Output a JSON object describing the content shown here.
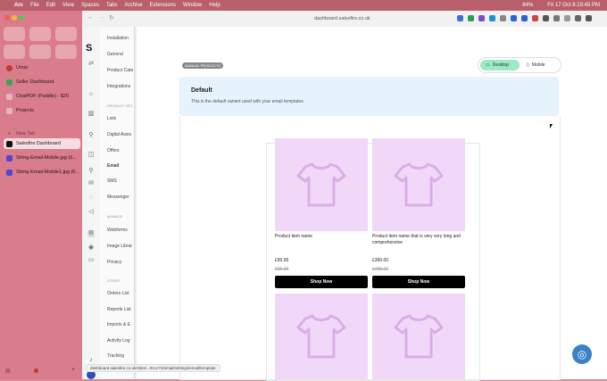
{
  "menubar": {
    "items": [
      "Arc",
      "File",
      "Edit",
      "View",
      "Spaces",
      "Tabs",
      "Archive",
      "Extensions",
      "Window",
      "Help"
    ],
    "battery": "84%",
    "datetime": "Fri 17 Oct  8:19:45 PM"
  },
  "arc_sidebar": {
    "items": [
      {
        "label": "Umar"
      },
      {
        "label": "Seller Dashboard"
      },
      {
        "label": "ChatPDF (Paddle) - $20"
      },
      {
        "label": "Projects"
      },
      {
        "label": "New Tab"
      },
      {
        "label": "Salesfire Dashboard"
      },
      {
        "label": "String-Email-Mobile.jpg (6..."
      },
      {
        "label": "String-Email-Mobile1.jpg (6..."
      }
    ],
    "colors": {
      "bg": "#d97c8b",
      "active": "#f7dde1"
    }
  },
  "browser": {
    "url": "dashboard.salesfire.co.uk"
  },
  "app_sidebar": {
    "items": [
      "Installation",
      "General",
      "Product Cata",
      "Integrations",
      "PRODUCT SET",
      "Lists",
      "Digital Assis",
      "Offers",
      "Email",
      "SMS",
      "Messenger",
      "MANAGE",
      "Webforms",
      "Image Librar",
      "Privacy",
      "OTHER",
      "Orders List",
      "Reports List",
      "Imports & E",
      "Activity Log",
      "Tracking"
    ]
  },
  "page": {
    "section_badge": "MANUAL PRODUCTS",
    "toggle": {
      "desktop": "Desktop",
      "mobile": "Mobile"
    },
    "banner": {
      "title": "Default",
      "subtitle": "This is the default variant used with your email templates."
    },
    "products": [
      {
        "name": "Product item name",
        "price": "£90.00",
        "compare": "£95.00",
        "button": "Shop Now"
      },
      {
        "name": "Product item name that is very very long and comprehensive",
        "price": "£390.00",
        "compare": "£495.00",
        "button": "Shop Now"
      }
    ]
  },
  "status_url": "dashboard.salesfire.co.uk/sites/...01cc72/email/settings/email/template",
  "colors": {
    "accent": "#9de8c5",
    "product_bg": "#f2d8f8",
    "help": "#3b82c4"
  }
}
